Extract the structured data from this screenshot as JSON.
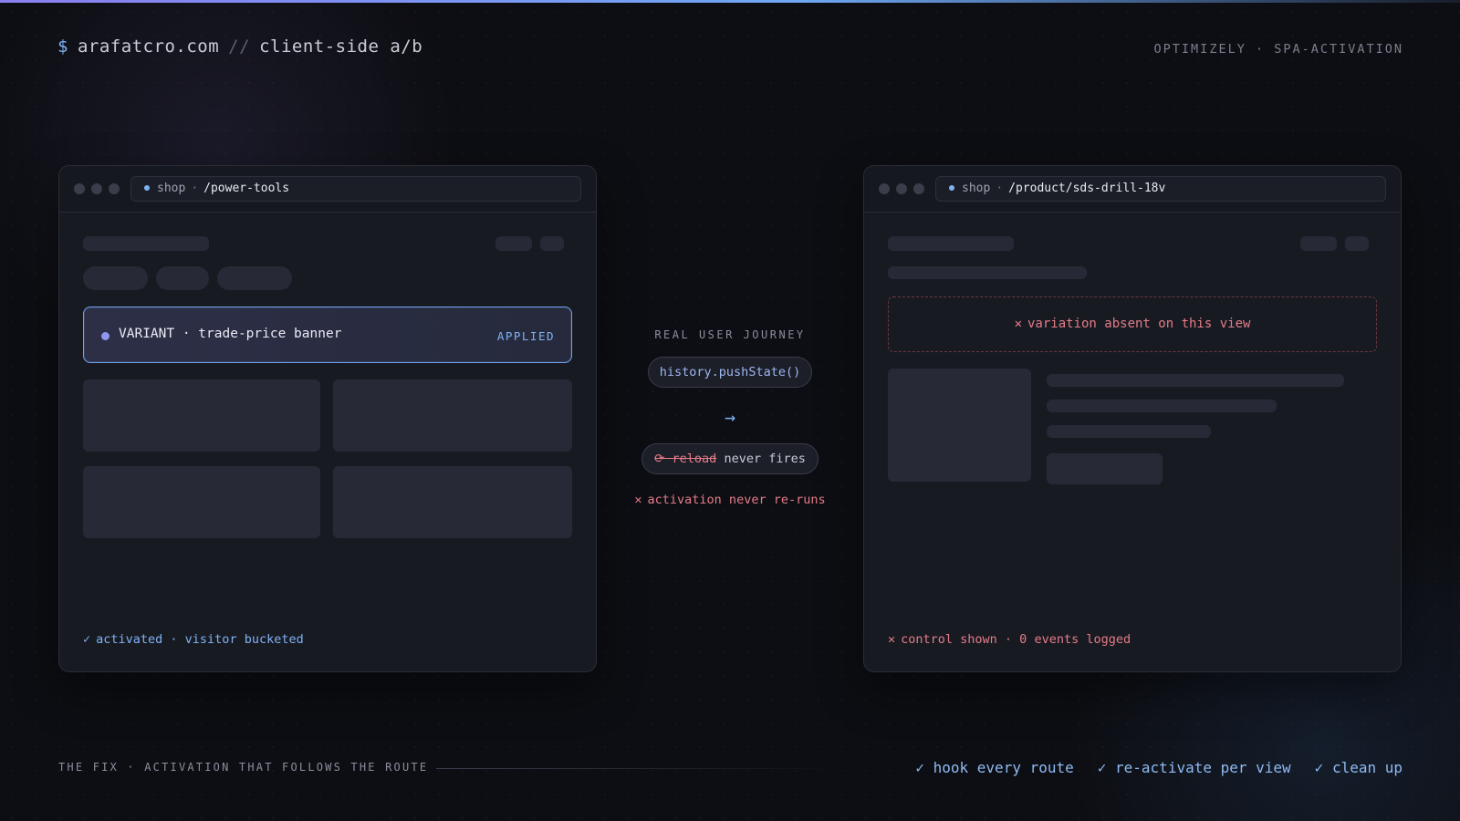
{
  "header": {
    "prompt": "$",
    "domain": "arafatcro.com",
    "separator": "//",
    "subtitle": "client-side a/b",
    "tagline": "OPTIMIZELY · SPA-ACTIVATION"
  },
  "left_window": {
    "url_prefix": "shop",
    "url_sep": "·",
    "url_path": "/power-tools",
    "variant_label": "VARIANT · trade-price banner",
    "variant_badge": "APPLIED",
    "status_mark": "✓",
    "status_text": "activated · visitor bucketed"
  },
  "journey": {
    "label": "REAL USER JOURNEY",
    "push_state": "history.pushState()",
    "arrow": "→",
    "reload_struck": "⟳ reload",
    "reload_rest": " never fires",
    "rerun_mark": "✕",
    "rerun_text": "activation never re-runs"
  },
  "right_window": {
    "url_prefix": "shop",
    "url_sep": "·",
    "url_path": "/product/sds-drill-18v",
    "absent_mark": "✕",
    "absent_text": "variation absent on this view",
    "status_mark": "✕",
    "status_text": "control shown · 0 events logged"
  },
  "footer": {
    "fix_label": "THE FIX · ACTIVATION THAT FOLLOWS THE ROUTE",
    "items": [
      "✓ hook every route",
      "✓ re-activate per view",
      "✓ clean up"
    ]
  },
  "colors": {
    "accent_blue": "#7fb2f5",
    "accent_violet": "#8f97f2",
    "error_red": "#e57c88",
    "background": "#0d0e13"
  }
}
